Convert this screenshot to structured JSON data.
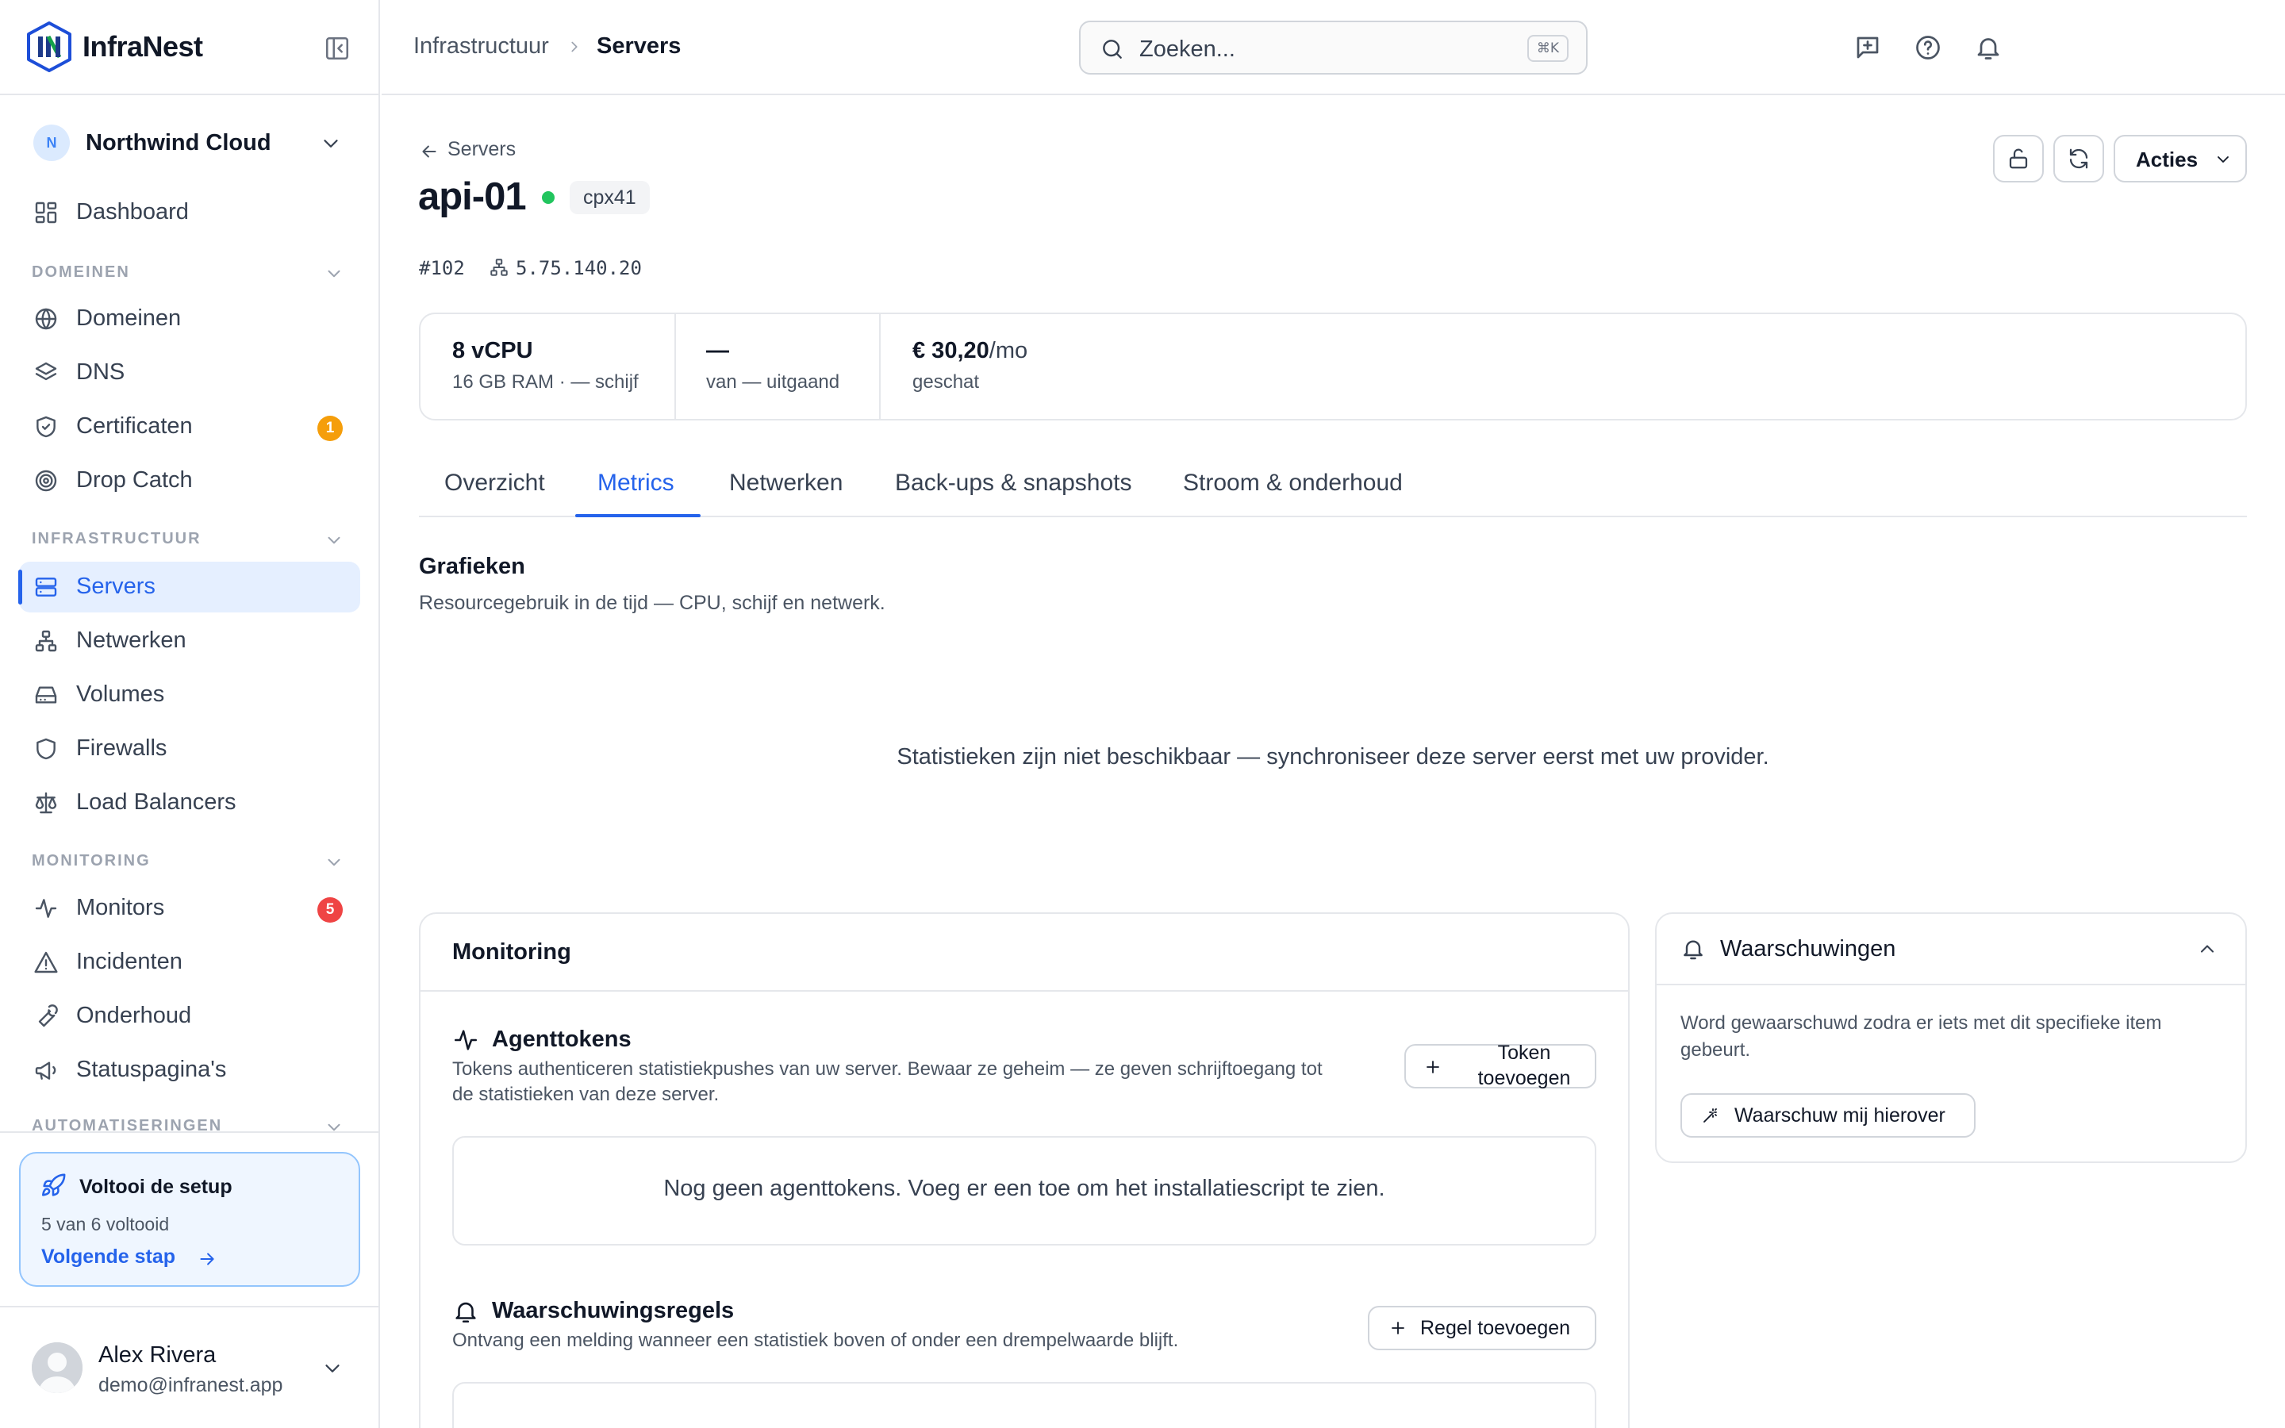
{
  "app": {
    "name": "InfraNest"
  },
  "org": {
    "initial": "N",
    "name": "Northwind Cloud"
  },
  "nav": {
    "dashboard": "Dashboard",
    "sections": {
      "domeinen": "DOMEINEN",
      "infrastructuur": "INFRASTRUCTUUR",
      "monitoring": "MONITORING",
      "automatiseringen": "AUTOMATISERINGEN"
    },
    "items": {
      "domeinen": "Domeinen",
      "dns": "DNS",
      "certificaten": "Certificaten",
      "certificaten_badge": "1",
      "drop_catch": "Drop Catch",
      "servers": "Servers",
      "netwerken": "Netwerken",
      "volumes": "Volumes",
      "firewalls": "Firewalls",
      "load_balancers": "Load Balancers",
      "monitors": "Monitors",
      "monitors_badge": "5",
      "incidenten": "Incidenten",
      "onderhoud": "Onderhoud",
      "statuspaginas": "Statuspagina's"
    }
  },
  "setup": {
    "title": "Voltooi de setup",
    "progress": "5 van 6 voltooid",
    "next": "Volgende stap",
    "completed": 5,
    "total": 6
  },
  "user": {
    "name": "Alex Rivera",
    "email": "demo@infranest.app"
  },
  "topbar": {
    "breadcrumb": [
      "Infrastructuur",
      "Servers"
    ],
    "search_placeholder": "Zoeken...",
    "search_shortcut": "⌘K"
  },
  "server": {
    "back_label": "Servers",
    "name": "api-01",
    "status": "running",
    "type": "cpx41",
    "id": "#102",
    "ip": "5.75.140.20",
    "actions_label": "Acties"
  },
  "specs": [
    {
      "value": "8 vCPU",
      "label": "16 GB RAM · — schijf"
    },
    {
      "value": "—",
      "label": "van — uitgaand"
    },
    {
      "value": "€ 30,20",
      "unit": "/mo",
      "label": "geschat"
    }
  ],
  "tabs": [
    "Overzicht",
    "Metrics",
    "Netwerken",
    "Back-ups & snapshots",
    "Stroom & onderhoud"
  ],
  "active_tab": "Metrics",
  "charts": {
    "title": "Grafieken",
    "subtitle": "Resourcegebruik in de tijd — CPU, schijf en netwerk.",
    "empty": "Statistieken zijn niet beschikbaar — synchroniseer deze server eerst met uw provider."
  },
  "monitoring": {
    "title": "Monitoring",
    "agent_tokens": {
      "title": "Agenttokens",
      "desc_line1": "Tokens authenticeren statistiekpushes van uw server. Bewaar ze geheim — ze geven schrijftoegang tot",
      "desc_line2": "de statistieken van deze server.",
      "button_line1": "Token",
      "button_line2": "toevoegen",
      "empty": "Nog geen agenttokens. Voeg er een toe om het installatiescript te zien."
    },
    "alert_rules": {
      "title": "Waarschuwingsregels",
      "desc": "Ontvang een melding wanneer een statistiek boven of onder een drempelwaarde blijft.",
      "button": "Regel toevoegen"
    }
  },
  "warnings": {
    "title": "Waarschuwingen",
    "desc_line1": "Word gewaarschuwd zodra er iets met dit specifieke item",
    "desc_line2": "gebeurt.",
    "button": "Waarschuw mij hierover"
  },
  "colors": {
    "accent": "#2563eb",
    "active_bg": "#e5efff",
    "status_online": "#22c55e",
    "badge_warning": "#f59e0b",
    "badge_danger": "#ef4444"
  }
}
